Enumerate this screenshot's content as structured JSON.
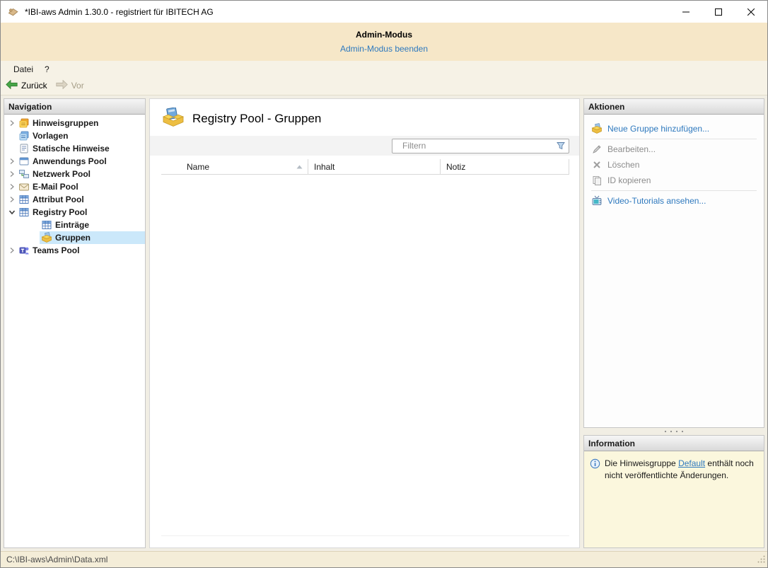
{
  "window": {
    "title": "*IBI-aws Admin 1.30.0 - registriert für IBITECH AG"
  },
  "admin_banner": {
    "title": "Admin-Modus",
    "link": "Admin-Modus beenden"
  },
  "menu": {
    "items": [
      {
        "label": "Datei"
      },
      {
        "label": "?"
      }
    ]
  },
  "toolbar": {
    "back_label": "Zurück",
    "forward_label": "Vor"
  },
  "navigation": {
    "header": "Navigation",
    "items": [
      {
        "label": "Hinweisgruppen",
        "icon": "hint-groups-icon",
        "expand": "collapsed",
        "level": 0,
        "selected": false
      },
      {
        "label": "Vorlagen",
        "icon": "templates-icon",
        "expand": "none",
        "level": 0,
        "selected": false
      },
      {
        "label": "Statische Hinweise",
        "icon": "static-hints-icon",
        "expand": "none",
        "level": 0,
        "selected": false
      },
      {
        "label": "Anwendungs Pool",
        "icon": "application-pool-icon",
        "expand": "collapsed",
        "level": 0,
        "selected": false
      },
      {
        "label": "Netzwerk Pool",
        "icon": "network-pool-icon",
        "expand": "collapsed",
        "level": 0,
        "selected": false
      },
      {
        "label": "E-Mail Pool",
        "icon": "email-pool-icon",
        "expand": "collapsed",
        "level": 0,
        "selected": false
      },
      {
        "label": "Attribut Pool",
        "icon": "attribute-pool-icon",
        "expand": "collapsed",
        "level": 0,
        "selected": false
      },
      {
        "label": "Registry Pool",
        "icon": "registry-pool-icon",
        "expand": "expanded",
        "level": 0,
        "selected": false
      },
      {
        "label": "Einträge",
        "icon": "registry-entries-icon",
        "expand": "none",
        "level": 1,
        "selected": false
      },
      {
        "label": "Gruppen",
        "icon": "groups-icon",
        "expand": "none",
        "level": 1,
        "selected": true
      },
      {
        "label": "Teams Pool",
        "icon": "teams-pool-icon",
        "expand": "collapsed",
        "level": 0,
        "selected": false
      }
    ]
  },
  "main": {
    "title": "Registry Pool - Gruppen",
    "filter_placeholder": "Filtern",
    "columns": [
      {
        "label": "Name",
        "sorted": "ascending"
      },
      {
        "label": "Inhalt",
        "sorted": "none"
      },
      {
        "label": "Notiz",
        "sorted": "none"
      }
    ],
    "rows": []
  },
  "actions": {
    "header": "Aktionen",
    "items": [
      {
        "label": "Neue Gruppe hinzufügen...",
        "enabled": true,
        "icon": "add-group-icon"
      },
      {
        "label": "Bearbeiten...",
        "enabled": false,
        "icon": "edit-icon"
      },
      {
        "label": "Löschen",
        "enabled": false,
        "icon": "delete-icon"
      },
      {
        "label": "ID kopieren",
        "enabled": false,
        "icon": "copy-id-icon"
      },
      {
        "label": "Video-Tutorials ansehen...",
        "enabled": true,
        "icon": "video-tutorials-icon"
      }
    ]
  },
  "information": {
    "header": "Information",
    "text_before": "Die Hinweisgruppe ",
    "link": "Default",
    "text_after": " enthält noch nicht veröffentlichte Änderungen."
  },
  "status_bar": {
    "path": "C:\\IBI-aws\\Admin\\Data.xml"
  },
  "colors": {
    "accent_link": "#2E79BE",
    "selection_blue": "#CBE8FA",
    "banner_bg": "#F6E7C8",
    "info_bg": "#FBF7DD",
    "status_bg": "#F4EDD8",
    "disabled_text": "#8C8C8C"
  }
}
